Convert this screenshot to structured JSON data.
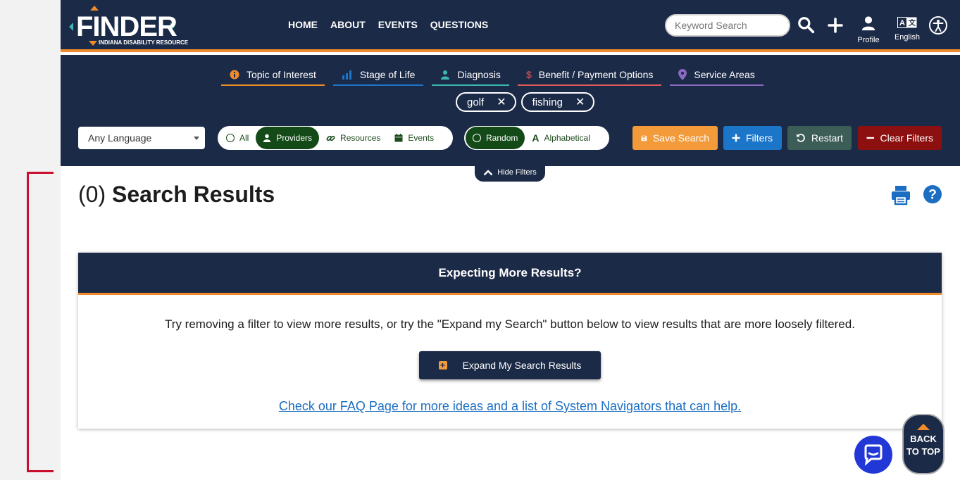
{
  "logo": {
    "name": "FINDER",
    "tagline": "INDIANA DISABILITY RESOURCE"
  },
  "nav": {
    "links": [
      "HOME",
      "ABOUT",
      "EVENTS",
      "QUESTIONS"
    ],
    "search_placeholder": "Keyword Search",
    "profile_label": "Profile",
    "language_label": "English",
    "icons": {
      "search": "search-icon",
      "add": "plus-icon",
      "profile": "user-icon",
      "language": "translate-icon",
      "accessibility": "accessibility-icon"
    }
  },
  "categories": [
    {
      "label": "Topic of Interest",
      "color": "#f08a2b",
      "icon": "info-icon"
    },
    {
      "label": "Stage of Life",
      "color": "#1b75c8",
      "icon": "bar-chart-icon"
    },
    {
      "label": "Diagnosis",
      "color": "#3bb8b0",
      "icon": "doctor-icon"
    },
    {
      "label": "Benefit / Payment Options",
      "color": "#e05a5a",
      "icon": "dollar-icon"
    },
    {
      "label": "Service Areas",
      "color": "#8a6ac0",
      "icon": "map-pin-icon"
    }
  ],
  "chips": [
    "golf",
    "fishing"
  ],
  "language_select": {
    "value": "Any Language"
  },
  "type_toggle": {
    "options": [
      "All",
      "Providers",
      "Resources",
      "Events"
    ],
    "selected": "Providers"
  },
  "sort_toggle": {
    "options": [
      "Random",
      "Alphabetical"
    ],
    "selected": "Random"
  },
  "actions": {
    "save": "Save Search",
    "filters": "Filters",
    "restart": "Restart",
    "clear": "Clear Filters"
  },
  "hide_filters_label": "Hide Filters",
  "results": {
    "count": "(0)",
    "label": "Search Results"
  },
  "card": {
    "title": "Expecting More Results?",
    "body": "Try removing a filter to view more results, or try the \"Expand my Search\" button below to view results that are more loosely filtered.",
    "expand_button": "Expand My Search Results",
    "faq_link": "Check our FAQ Page for more ideas and a list of System Navigators that can help."
  },
  "back_to_top": {
    "line1": "BACK",
    "line2": "TO TOP"
  },
  "colors": {
    "navy": "#1b2a47",
    "orange": "#f08a2b",
    "green": "#134a17",
    "blue": "#1b75c8",
    "red": "#8d1010",
    "link": "#1b6ec2"
  }
}
